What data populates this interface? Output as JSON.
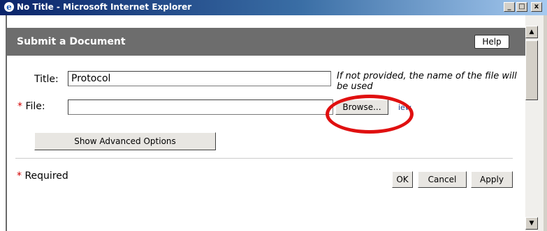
{
  "window": {
    "title": "No Title - Microsoft Internet Explorer",
    "logo_glyph": "e",
    "minimize_glyph": "_",
    "maximize_glyph": "□",
    "close_glyph": "x"
  },
  "dialog": {
    "heading": "Submit a Document",
    "help_label": "Help"
  },
  "form": {
    "title_label": "Title:",
    "title_value": "Protocol",
    "title_hint": "If not provided, the name of the file will be used",
    "required_star": "*",
    "file_label": "File:",
    "file_value": "",
    "browse_label": "Browse...",
    "partial_link_text": "iew",
    "advanced_label": "Show Advanced Options"
  },
  "footer": {
    "required_note": "Required",
    "ok_label": "OK",
    "cancel_label": "Cancel",
    "apply_label": "Apply"
  },
  "scrollbar": {
    "up_glyph": "▲",
    "down_glyph": "▼"
  },
  "colors": {
    "header_bg": "#6d6d6d",
    "annotation_ring": "#e01010",
    "required_star": "#d20000"
  }
}
